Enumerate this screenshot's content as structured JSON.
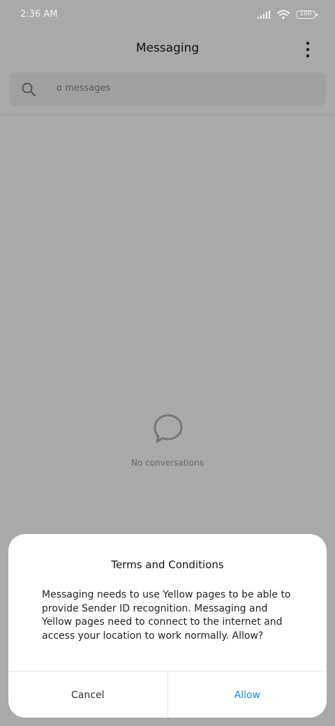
{
  "status_bar": {
    "time": "2:36 AM",
    "battery": "100",
    "icons": [
      "signal-icon",
      "wifi-icon",
      "battery-icon"
    ]
  },
  "header": {
    "title": "Messaging",
    "menu_icon": "more-vert-icon"
  },
  "search": {
    "text": "o messages",
    "icon": "search-icon"
  },
  "empty_state": {
    "icon": "chat-bubble-icon",
    "text": "No conversations"
  },
  "dialog": {
    "title": "Terms and Conditions",
    "message": "Messaging needs to use Yellow pages to be able to provide Sender ID recognition. Messaging and Yellow pages need to connect to the internet and access your location to work normally. Allow?",
    "cancel_label": "Cancel",
    "allow_label": "Allow"
  },
  "colors": {
    "accent": "#0f8ce9",
    "overlay": "#a9a9a9",
    "dialog_bg": "#ffffff"
  }
}
